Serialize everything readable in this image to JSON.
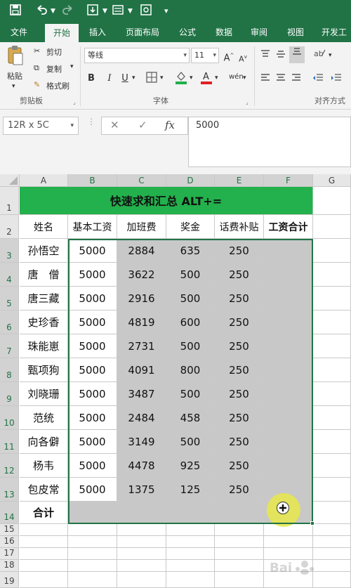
{
  "quick_access": {
    "save_icon": "save-icon",
    "undo_icon": "undo-icon",
    "redo_icon": "redo-icon",
    "customize_icon": "dropdown-icon"
  },
  "tabs": [
    "文件",
    "开始",
    "插入",
    "页面布局",
    "公式",
    "数据",
    "审阅",
    "视图",
    "开发工"
  ],
  "active_tab": "开始",
  "ribbon": {
    "clipboard": {
      "paste": "粘贴",
      "cut": "剪切",
      "copy": "复制",
      "format_painter": "格式刷",
      "group": "剪贴板"
    },
    "font": {
      "name": "等线",
      "size": "11",
      "grow": "A",
      "shrink": "A",
      "bold": "B",
      "italic": "I",
      "underline": "U",
      "phonetic": "wén",
      "group": "字体"
    },
    "alignment": {
      "group": "对齐方式"
    }
  },
  "formula_bar": {
    "name_box": "12R x 5C",
    "cancel": "✕",
    "confirm": "✓",
    "fx": "fx",
    "value": "5000"
  },
  "columns": [
    "A",
    "B",
    "C",
    "D",
    "E",
    "F",
    "G"
  ],
  "rows": [
    "1",
    "2",
    "3",
    "4",
    "5",
    "6",
    "7",
    "8",
    "9",
    "10",
    "11",
    "12",
    "13",
    "14",
    "15",
    "16",
    "17",
    "18",
    "19"
  ],
  "sheet": {
    "title": "快速求和汇总 ALT+=",
    "headers": [
      "姓名",
      "基本工资",
      "加班费",
      "奖金",
      "话费补贴",
      "工资合计"
    ],
    "data": [
      [
        "孙悟空",
        "5000",
        "2884",
        "635",
        "250",
        ""
      ],
      [
        "唐　僧",
        "5000",
        "3622",
        "500",
        "250",
        ""
      ],
      [
        "唐三藏",
        "5000",
        "2916",
        "500",
        "250",
        ""
      ],
      [
        "史珍香",
        "5000",
        "4819",
        "600",
        "250",
        ""
      ],
      [
        "珠能崽",
        "5000",
        "2731",
        "500",
        "250",
        ""
      ],
      [
        "甄项狗",
        "5000",
        "4091",
        "800",
        "250",
        ""
      ],
      [
        "刘晓珊",
        "5000",
        "3487",
        "500",
        "250",
        ""
      ],
      [
        "范统",
        "5000",
        "2484",
        "458",
        "250",
        ""
      ],
      [
        "向各僻",
        "5000",
        "3149",
        "500",
        "250",
        ""
      ],
      [
        "杨韦",
        "5000",
        "4478",
        "925",
        "250",
        ""
      ],
      [
        "包皮常",
        "5000",
        "1375",
        "125",
        "250",
        ""
      ]
    ],
    "total_label": "合计"
  },
  "colors": {
    "brand": "#217346",
    "title_fill": "#22b14c",
    "selection_fill": "#c8c8c8",
    "cursor": "#e8e84a"
  }
}
